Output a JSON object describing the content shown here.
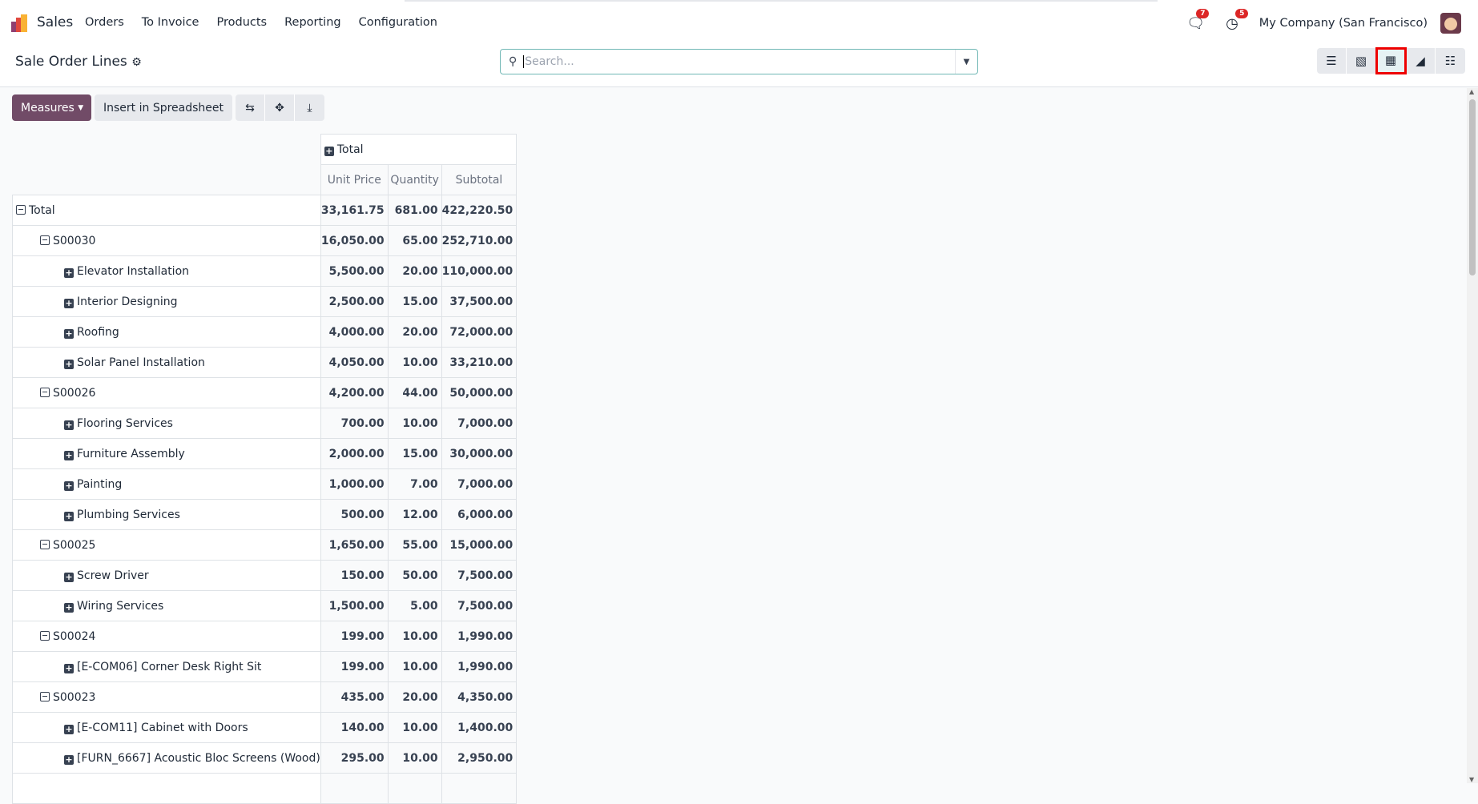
{
  "navbar": {
    "app": "Sales",
    "menu": [
      "Orders",
      "To Invoice",
      "Products",
      "Reporting",
      "Configuration"
    ],
    "messages_count": "7",
    "activities_count": "5",
    "company": "My Company (San Francisco)"
  },
  "control_panel": {
    "title": "Sale Order Lines",
    "search_placeholder": "Search...",
    "views": [
      "list",
      "kanban",
      "pivot",
      "graph",
      "calendar"
    ],
    "active_view": "pivot"
  },
  "toolbar": {
    "measures": "Measures",
    "insert": "Insert in Spreadsheet"
  },
  "pivot": {
    "col_header": "Total",
    "measures": [
      "Unit Price",
      "Quantity",
      "Subtotal"
    ],
    "rows": [
      {
        "level": 0,
        "expanded": true,
        "label": "Total",
        "values": [
          "33,161.75",
          "681.00",
          "422,220.50"
        ]
      },
      {
        "level": 1,
        "expanded": true,
        "label": "S00030",
        "values": [
          "16,050.00",
          "65.00",
          "252,710.00"
        ]
      },
      {
        "level": 2,
        "expanded": false,
        "label": "Elevator Installation",
        "values": [
          "5,500.00",
          "20.00",
          "110,000.00"
        ]
      },
      {
        "level": 2,
        "expanded": false,
        "label": "Interior Designing",
        "values": [
          "2,500.00",
          "15.00",
          "37,500.00"
        ]
      },
      {
        "level": 2,
        "expanded": false,
        "label": "Roofing",
        "values": [
          "4,000.00",
          "20.00",
          "72,000.00"
        ]
      },
      {
        "level": 2,
        "expanded": false,
        "label": "Solar Panel Installation",
        "values": [
          "4,050.00",
          "10.00",
          "33,210.00"
        ]
      },
      {
        "level": 1,
        "expanded": true,
        "label": "S00026",
        "values": [
          "4,200.00",
          "44.00",
          "50,000.00"
        ]
      },
      {
        "level": 2,
        "expanded": false,
        "label": "Flooring Services",
        "values": [
          "700.00",
          "10.00",
          "7,000.00"
        ]
      },
      {
        "level": 2,
        "expanded": false,
        "label": "Furniture Assembly",
        "values": [
          "2,000.00",
          "15.00",
          "30,000.00"
        ]
      },
      {
        "level": 2,
        "expanded": false,
        "label": "Painting",
        "values": [
          "1,000.00",
          "7.00",
          "7,000.00"
        ]
      },
      {
        "level": 2,
        "expanded": false,
        "label": "Plumbing Services",
        "values": [
          "500.00",
          "12.00",
          "6,000.00"
        ]
      },
      {
        "level": 1,
        "expanded": true,
        "label": "S00025",
        "values": [
          "1,650.00",
          "55.00",
          "15,000.00"
        ]
      },
      {
        "level": 2,
        "expanded": false,
        "label": "Screw Driver",
        "values": [
          "150.00",
          "50.00",
          "7,500.00"
        ]
      },
      {
        "level": 2,
        "expanded": false,
        "label": "Wiring Services",
        "values": [
          "1,500.00",
          "5.00",
          "7,500.00"
        ]
      },
      {
        "level": 1,
        "expanded": true,
        "label": "S00024",
        "values": [
          "199.00",
          "10.00",
          "1,990.00"
        ]
      },
      {
        "level": 2,
        "expanded": false,
        "label": "[E-COM06] Corner Desk Right Sit",
        "values": [
          "199.00",
          "10.00",
          "1,990.00"
        ]
      },
      {
        "level": 1,
        "expanded": true,
        "label": "S00023",
        "values": [
          "435.00",
          "20.00",
          "4,350.00"
        ]
      },
      {
        "level": 2,
        "expanded": false,
        "label": "[E-COM11] Cabinet with Doors",
        "values": [
          "140.00",
          "10.00",
          "1,400.00"
        ]
      },
      {
        "level": 2,
        "expanded": false,
        "label": "[FURN_6667] Acoustic Bloc Screens (Wood)",
        "values": [
          "295.00",
          "10.00",
          "2,950.00"
        ]
      }
    ]
  }
}
